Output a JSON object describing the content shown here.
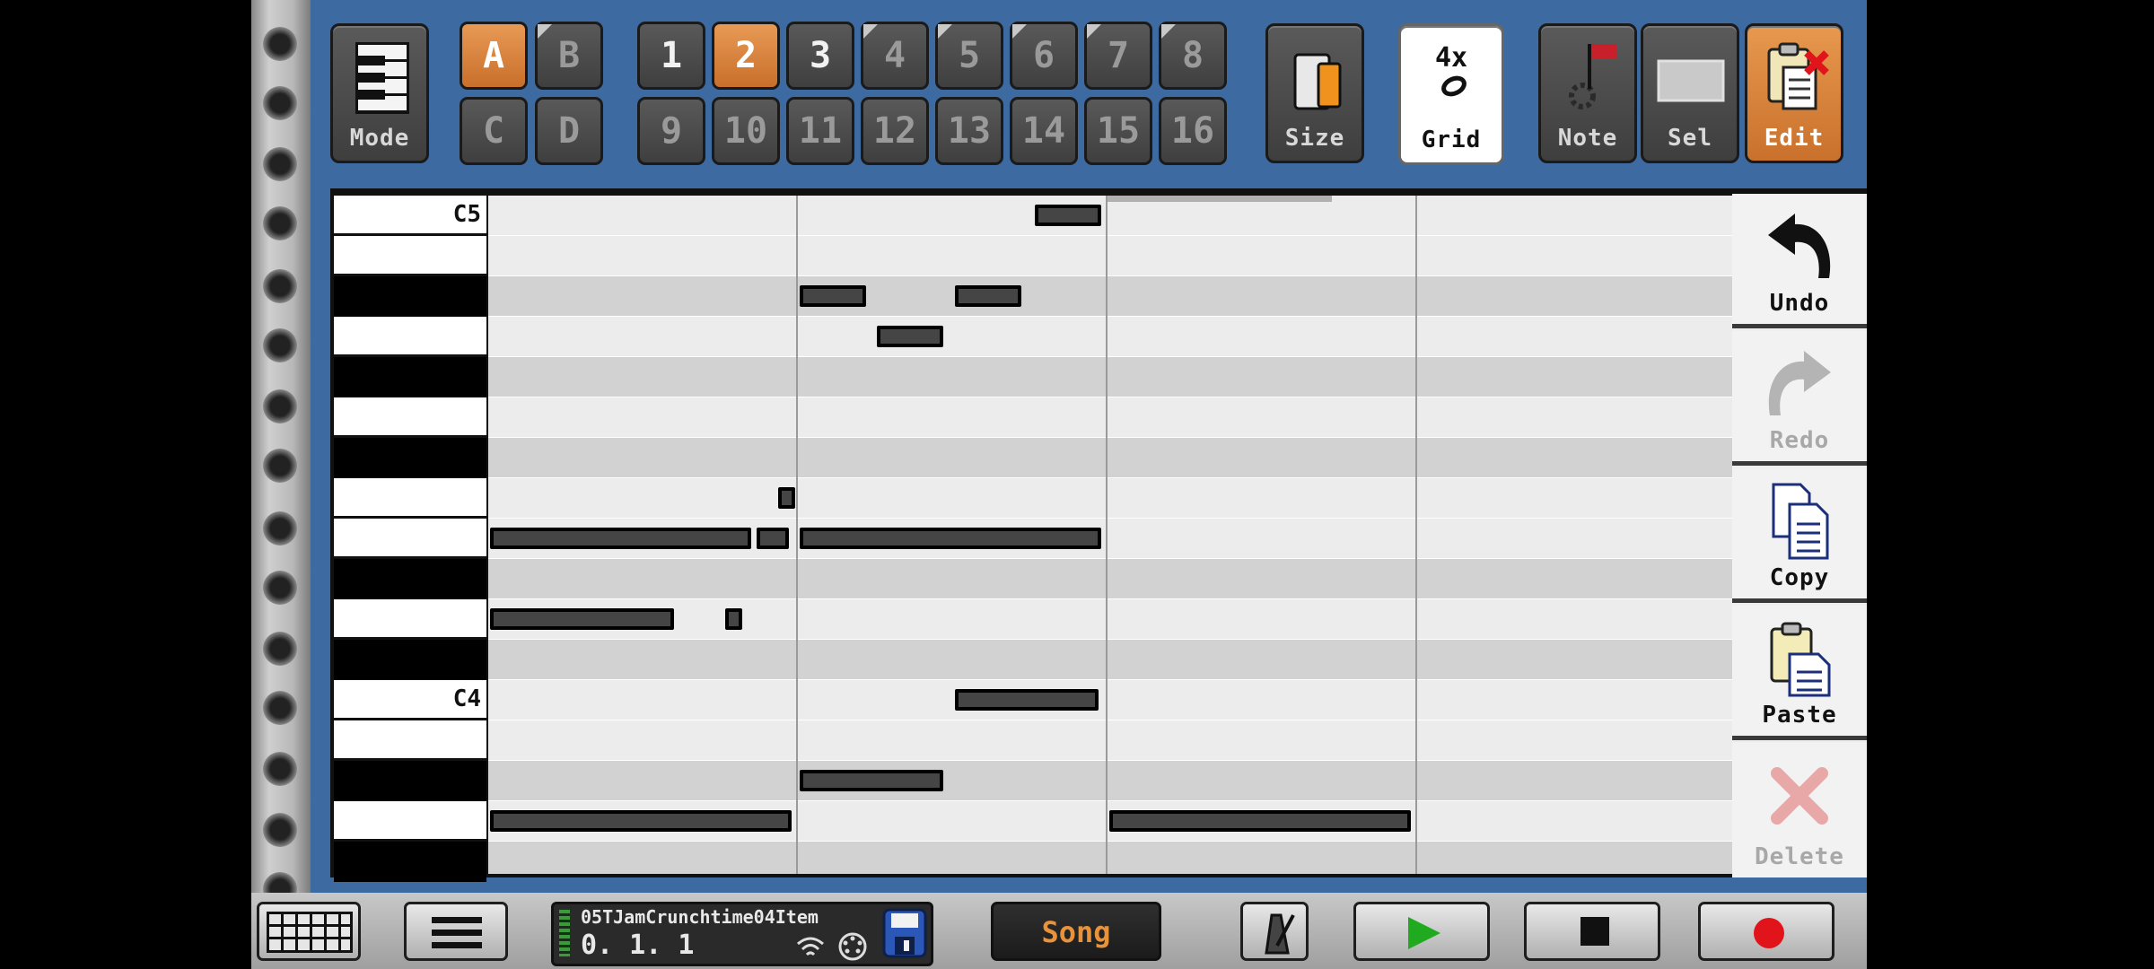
{
  "header": {
    "mode": {
      "label": "Mode"
    },
    "banks": [
      {
        "label": "A",
        "active": true
      },
      {
        "label": "B",
        "active": false
      },
      {
        "label": "C",
        "active": false
      },
      {
        "label": "D",
        "active": false
      }
    ],
    "patterns": [
      "1",
      "2",
      "3",
      "4",
      "5",
      "6",
      "7",
      "8",
      "9",
      "10",
      "11",
      "12",
      "13",
      "14",
      "15",
      "16"
    ],
    "active_pattern": "2",
    "size": {
      "label": "Size"
    },
    "grid": {
      "value": "4x",
      "label": "Grid"
    },
    "note": {
      "label": "Note"
    },
    "sel": {
      "label": "Sel"
    },
    "edit": {
      "label": "Edit"
    }
  },
  "piano_roll": {
    "key_labels": {
      "c5": "C5",
      "c4": "C4"
    },
    "notes_by_pitch": [
      {
        "pitch": "C5",
        "start": 1.76,
        "length": 0.22
      },
      {
        "pitch": "A#4",
        "start": 1.0,
        "length": 0.22
      },
      {
        "pitch": "A#4",
        "start": 1.5,
        "length": 0.22
      },
      {
        "pitch": "A4",
        "start": 1.25,
        "length": 0.22
      },
      {
        "pitch": "F4",
        "start": 0.93,
        "length": 0.06
      },
      {
        "pitch": "E4",
        "start": 0.0,
        "length": 0.85
      },
      {
        "pitch": "E4",
        "start": 0.86,
        "length": 0.11
      },
      {
        "pitch": "E4",
        "start": 1.0,
        "length": 0.98
      },
      {
        "pitch": "D4",
        "start": 0.0,
        "length": 0.6
      },
      {
        "pitch": "D4",
        "start": 0.76,
        "length": 0.06
      },
      {
        "pitch": "C4",
        "start": 1.5,
        "length": 0.47
      },
      {
        "pitch": "A#3",
        "start": 1.0,
        "length": 0.47
      },
      {
        "pitch": "A3",
        "start": 0.0,
        "length": 0.98
      },
      {
        "pitch": "A3",
        "start": 2.0,
        "length": 0.98
      }
    ]
  },
  "side_actions": [
    {
      "label": "Undo",
      "enabled": true
    },
    {
      "label": "Redo",
      "enabled": false
    },
    {
      "label": "Copy",
      "enabled": true
    },
    {
      "label": "Paste",
      "enabled": true
    },
    {
      "label": "Delete",
      "enabled": false
    }
  ],
  "footer": {
    "song_name": "05TJamCrunchtime04Item",
    "position": "0. 1. 1",
    "song_button": "Song",
    "colors": {
      "accent": "#e8923a",
      "play": "#1faa1f",
      "record": "#e0141a"
    }
  }
}
